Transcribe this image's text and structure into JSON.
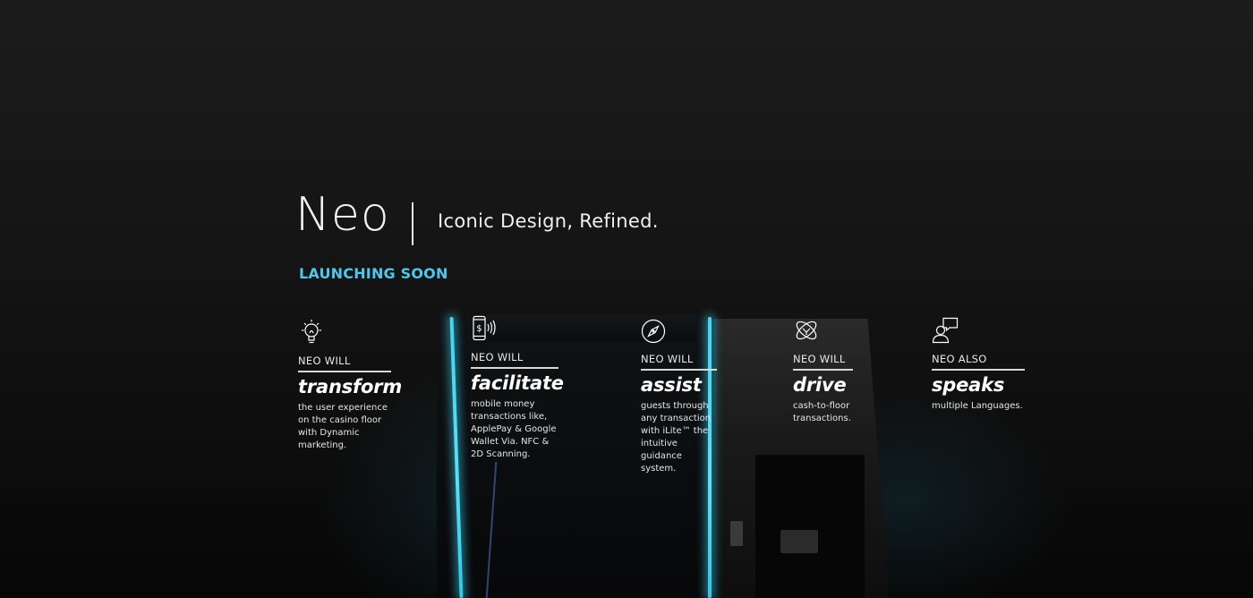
{
  "hero": {
    "brand": "Neo",
    "tagline": "Iconic Design, Refined.",
    "launch_label": "LAUNCHING SOON",
    "accent_color": "#4cc8ee",
    "glow_color": "#3fd6f2"
  },
  "features": [
    {
      "icon": "lightbulb-icon",
      "kicker": "NEO WILL",
      "verb": "transform",
      "description": "the user experience\non the casino floor\nwith Dynamic\nmarketing."
    },
    {
      "icon": "mobile-payment-icon",
      "kicker": "NEO WILL",
      "verb": "facilitate",
      "description": "mobile money\ntransactions like,\nApplePay & Google\nWallet Via. NFC &\n2D Scanning."
    },
    {
      "icon": "compass-icon",
      "kicker": "NEO WILL",
      "verb": "assist",
      "description": "guests through\nany transaction\nwith iLite™ the\nintuitive guidance\nsystem."
    },
    {
      "icon": "orbit-icon",
      "kicker": "NEO WILL",
      "verb": "drive",
      "description": "cash-to-floor\ntransactions."
    },
    {
      "icon": "speech-bubble-person-icon",
      "kicker": "NEO ALSO",
      "verb": "speaks",
      "description": "multiple Languages."
    }
  ]
}
